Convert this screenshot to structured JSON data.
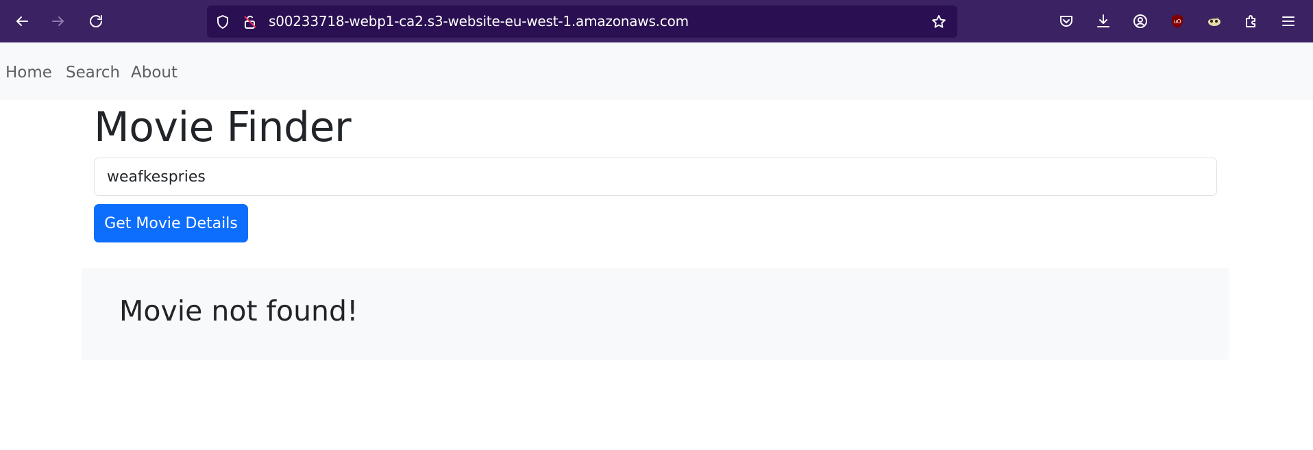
{
  "browser": {
    "url": "s00233718-webp1-ca2.s3-website-eu-west-1.amazonaws.com",
    "icons": [
      "back-icon",
      "forward-icon",
      "reload-icon",
      "shield-icon",
      "lock-warning-icon",
      "star-icon",
      "pocket-icon",
      "download-icon",
      "account-icon",
      "ublock-icon",
      "extension-avatar-icon",
      "extensions-icon",
      "menu-icon"
    ],
    "colors": {
      "toolbar": "#3b2263",
      "urlbar": "#2a1052"
    }
  },
  "nav": {
    "items": [
      {
        "label": "Home"
      },
      {
        "label": "Search"
      },
      {
        "label": "About"
      }
    ]
  },
  "page": {
    "title": "Movie Finder",
    "search": {
      "value": "weafkespries",
      "placeholder": ""
    },
    "button_label": "Get Movie Details",
    "result_message": "Movie not found!",
    "colors": {
      "primary": "#0d6efd",
      "light_bg": "#f8f9fa"
    }
  }
}
